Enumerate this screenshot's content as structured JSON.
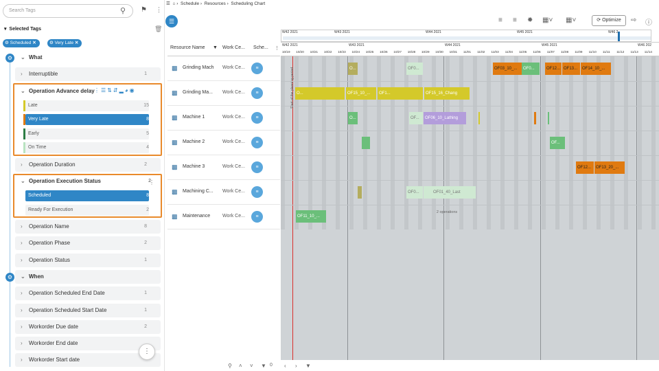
{
  "search": {
    "placeholder": "Search Tags"
  },
  "selected_tags": {
    "title": "Selected Tags",
    "chips": [
      "Scheduled",
      "Very Late"
    ]
  },
  "groups": {
    "what": "What",
    "when": "When"
  },
  "rows": [
    {
      "label": "Interruptible",
      "count": "1"
    },
    {
      "label": "Operation Advance delay",
      "count": ""
    },
    {
      "label": "Operation Duration",
      "count": "2"
    },
    {
      "label": "Operation Execution Status",
      "count": "2"
    },
    {
      "label": "Operation Name",
      "count": "8"
    },
    {
      "label": "Operation Phase",
      "count": "2"
    },
    {
      "label": "Operation Status",
      "count": "1"
    },
    {
      "label": "Operation Scheduled End Date",
      "count": "1"
    },
    {
      "label": "Operation Scheduled Start Date",
      "count": "1"
    },
    {
      "label": "Workorder Due date",
      "count": "2"
    },
    {
      "label": "Workorder End date",
      "count": ""
    },
    {
      "label": "Workorder Start date",
      "count": ""
    }
  ],
  "advance_values": [
    {
      "label": "Late",
      "count": "15",
      "color": "#d4c92a"
    },
    {
      "label": "Very Late",
      "count": "8",
      "color": "#e07a10"
    },
    {
      "label": "Early",
      "count": "5",
      "color": "#2e7d45"
    },
    {
      "label": "On Time",
      "count": "4",
      "color": "#b9e3c0"
    }
  ],
  "exec_values": [
    {
      "label": "Scheduled",
      "count": "8"
    },
    {
      "label": "Ready For Execution",
      "count": "2"
    }
  ],
  "breadcrumb": [
    "Schedule",
    "Resources",
    "Scheduling Chart"
  ],
  "toolbar": {
    "optimize": "Optimize"
  },
  "columns": {
    "resource": "Resource Name",
    "work_center": "Work Ce...",
    "schedule": "Sche..."
  },
  "resources": [
    {
      "name": "Grinding Mach",
      "wc": "Work Ce..."
    },
    {
      "name": "Grinding Ma...",
      "wc": "Work Ce..."
    },
    {
      "name": "Machine 1",
      "wc": "Work Ce..."
    },
    {
      "name": "Machine 2",
      "wc": "Work Ce..."
    },
    {
      "name": "Machine 3",
      "wc": "Work Ce..."
    },
    {
      "name": "Machining C...",
      "wc": "Work Ce..."
    },
    {
      "name": "Maintenance",
      "wc": "Work Ce..."
    }
  ],
  "timeline": {
    "overview_weeks": [
      "W42 2021",
      "W43 2021",
      "W44 2021",
      "W45 2021",
      "W46 2"
    ],
    "weeks": [
      "W42 2021",
      "W43 2021",
      "W44 2021",
      "W45 2021",
      "W46 202"
    ],
    "days": [
      "10/19",
      "10/20",
      "10/21",
      "10/22",
      "10/23",
      "10/24",
      "10/25",
      "10/26",
      "10/27",
      "10/28",
      "10/29",
      "10/30",
      "10/31",
      "11/01",
      "11/02",
      "11/03",
      "11/04",
      "11/05",
      "11/06",
      "11/07",
      "11/08",
      "11/09",
      "11/10",
      "11/11",
      "11/12",
      "11/13",
      "11/14"
    ],
    "planning_label": "Start of the planning period"
  },
  "bars": [
    {
      "row": 0,
      "label": "O...",
      "color": "#b4ad5e"
    },
    {
      "row": 0,
      "label": "OF0...",
      "color": "#cfe9d2"
    },
    {
      "row": 0,
      "label": "OF03_10_...",
      "color": "#e07a10"
    },
    {
      "row": 0,
      "label": "OF0...",
      "color": "#6bbf7a"
    },
    {
      "row": 0,
      "label": "OF12...",
      "color": "#e07a10"
    },
    {
      "row": 0,
      "label": "OF13...",
      "color": "#e07a10"
    },
    {
      "row": 0,
      "label": "OF14_10_...",
      "color": "#e07a10"
    },
    {
      "row": 1,
      "label": "O...",
      "color": "#d4c92a"
    },
    {
      "row": 1,
      "label": "OF15_10_...",
      "color": "#d4c92a"
    },
    {
      "row": 1,
      "label": "OF1...",
      "color": "#d4c92a"
    },
    {
      "row": 1,
      "label": "OF15_16_Chang",
      "color": "#d4c92a"
    },
    {
      "row": 2,
      "label": "O...",
      "color": "#6bbf7a"
    },
    {
      "row": 2,
      "label": "OF...",
      "color": "#cfe9d2"
    },
    {
      "row": 2,
      "label": "OF06_10_Lathing",
      "color": "#b39ddb"
    },
    {
      "row": 3,
      "label": "OF...",
      "color": "#6bbf7a"
    },
    {
      "row": 4,
      "label": "OF12...",
      "color": "#e07a10"
    },
    {
      "row": 4,
      "label": "OF13_20_...",
      "color": "#e07a10"
    },
    {
      "row": 5,
      "label": "OF0...",
      "color": "#cfe9d2"
    },
    {
      "row": 5,
      "label": "OF01_40_Last",
      "color": "#cfe9d2"
    },
    {
      "row": 6,
      "label": "OF11_10_...",
      "color": "#6bbf7a"
    },
    {
      "row": 6,
      "label": "2 operations",
      "color": "#cfd3d6"
    }
  ],
  "bottom": {
    "filter_count": "0"
  }
}
